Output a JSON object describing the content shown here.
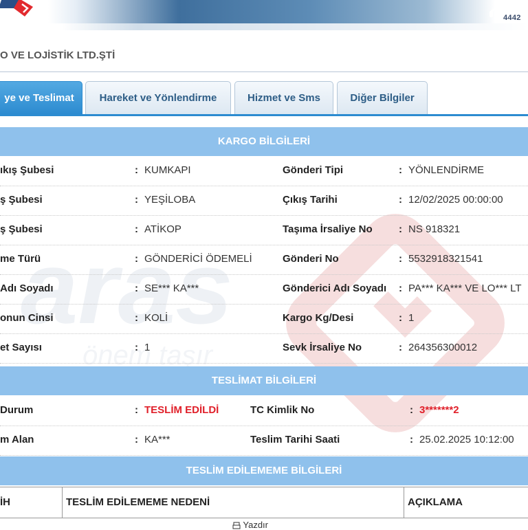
{
  "header": {
    "phone_number": "4442"
  },
  "company": {
    "name": "O VE LOJİSTİK LTD.ŞTİ"
  },
  "tabs": [
    {
      "label": "ye ve Teslimat",
      "active": true
    },
    {
      "label": "Hareket ve Yönlendirme",
      "active": false
    },
    {
      "label": "Hizmet ve Sms",
      "active": false
    },
    {
      "label": "Diğer Bilgiler",
      "active": false
    }
  ],
  "kargo": {
    "title": "KARGO BİLGİLERİ",
    "rows": [
      {
        "left_label": "ıkış Şubesi",
        "left_value": "KUMKAPI",
        "right_label": "Gönderi Tipi",
        "right_value": "YÖNLENDİRME"
      },
      {
        "left_label": "ş Şubesi",
        "left_value": "YEŞİLOBA",
        "right_label": "Çıkış Tarihi",
        "right_value": "12/02/2025 00:00:00"
      },
      {
        "left_label": "ş Şubesi",
        "left_value": "ATİKOP",
        "right_label": "Taşıma İrsaliye No",
        "right_value": "NS 918321"
      },
      {
        "left_label": "me Türü",
        "left_value": "GÖNDERİCİ ÖDEMELİ",
        "right_label": "Gönderi No",
        "right_value": "5532918321541"
      },
      {
        "left_label": "Adı Soyadı",
        "left_value": "SE*** KA***",
        "right_label": "Gönderici Adı Soyadı",
        "right_value": "PA*** KA*** VE LO*** LT"
      },
      {
        "left_label": "onun Cinsi",
        "left_value": "KOLİ",
        "right_label": "Kargo Kg/Desi",
        "right_value": "1"
      },
      {
        "left_label": "et Sayısı",
        "left_value": "1",
        "right_label": "Sevk İrsaliye No",
        "right_value": "264356300012"
      }
    ]
  },
  "teslimat": {
    "title": "TESLİMAT BİLGİLERİ",
    "rows": [
      {
        "left_label": "Durum",
        "left_value": "TESLİM EDİLDİ",
        "right_label": "TC Kimlik No",
        "right_value": "3*******2"
      },
      {
        "left_label": "m Alan",
        "left_value": "KA***",
        "right_label": "Teslim Tarihi Saati",
        "right_value": "25.02.2025 10:12:00"
      }
    ]
  },
  "teslim_edilememe": {
    "title": "TESLİM EDİLEMEME BİLGİLERİ",
    "columns": [
      "İH",
      "TESLİM EDİLEMEME NEDENİ",
      "AÇIKLAMA"
    ]
  },
  "print": {
    "label": "Yazdır"
  },
  "colors": {
    "accent_blue": "#2c8bd0",
    "section_blue": "#8fc1ec",
    "alert_red": "#e0202a"
  }
}
